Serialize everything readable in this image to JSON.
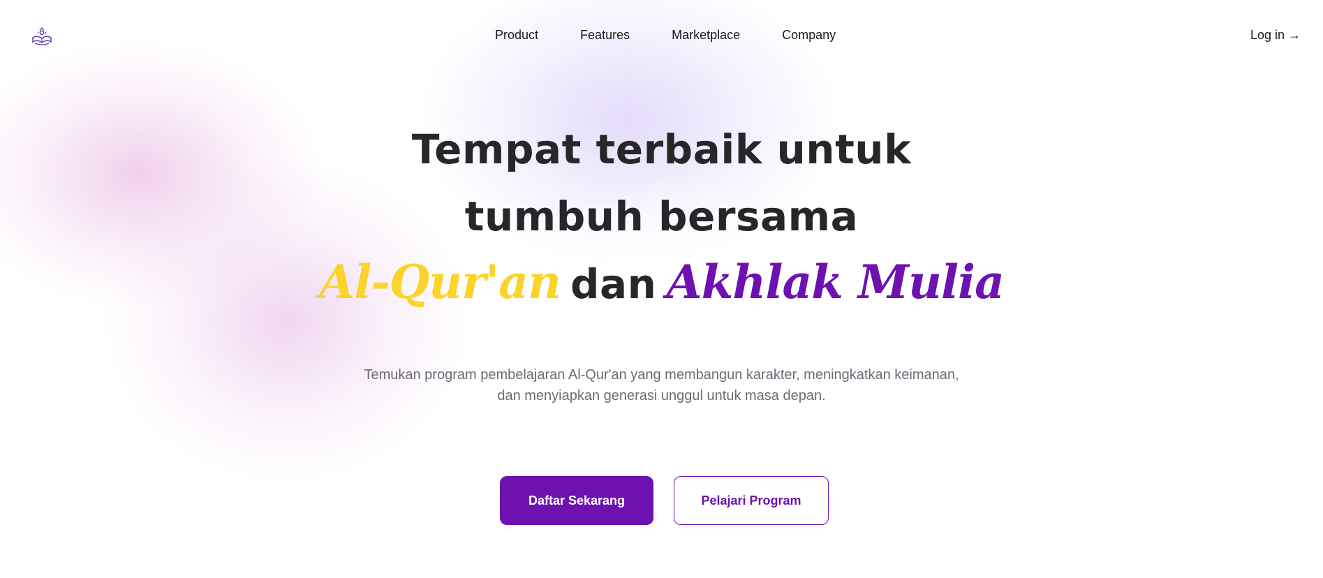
{
  "nav": {
    "logo_icon": "quran-book-icon",
    "links": [
      {
        "label": "Product"
      },
      {
        "label": "Features"
      },
      {
        "label": "Marketplace"
      },
      {
        "label": "Company"
      }
    ],
    "login_label": "Log in →"
  },
  "hero": {
    "line1": "Tempat terbaik untuk",
    "line2": "tumbuh bersama",
    "highlight1": "Al-Qur'an",
    "connector": "dan",
    "highlight2": "Akhlak Mulia",
    "subtitle_line1": "Temukan program pembelajaran Al-Qur'an yang membangun karakter, meningkatkan keimanan,",
    "subtitle_line2": "dan menyiapkan generasi unggul untuk masa depan.",
    "primary_button": "Daftar Sekarang",
    "secondary_button": "Pelajari Program"
  },
  "colors": {
    "accent_purple": "#6d12b0",
    "accent_yellow": "#fcd32b",
    "heading": "#27272a",
    "body_text": "#6b6b76"
  }
}
